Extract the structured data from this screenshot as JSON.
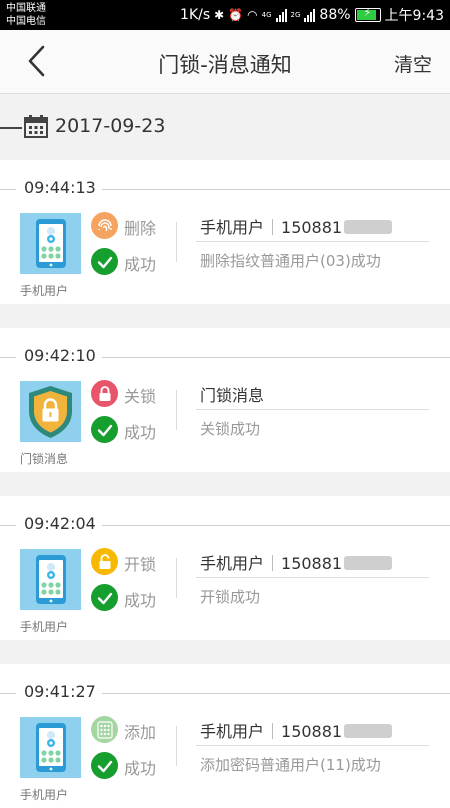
{
  "status_bar": {
    "carrier_1": "中国联通",
    "carrier_2": "中国电信",
    "speed": "1K/s",
    "net_1": "4G",
    "net_2": "2G",
    "battery": "88%",
    "time": "上午9:43"
  },
  "header": {
    "title": "门锁-消息通知",
    "clear_label": "清空"
  },
  "date": "2017-09-23",
  "icons": {
    "back": "back-arrow-icon",
    "calendar": "calendar-icon",
    "fingerprint": "fingerprint-icon",
    "lock_closed": "lock-icon",
    "lock_open": "unlock-icon",
    "keypad": "keypad-icon",
    "success": "check-icon",
    "phone_device": "phone-device-icon",
    "door_lock_device": "shield-lock-icon"
  },
  "colors": {
    "success_green": "#169f2e",
    "delete_orange": "#f4a460",
    "close_red": "#e8556b",
    "open_yellow": "#f6b800",
    "add_green": "#a3d6a0",
    "device_bg": "#8fd0ef"
  },
  "messages": [
    {
      "time": "09:44:13",
      "caption": "手机用户",
      "action": "删除",
      "result": "成功",
      "source": "手机用户",
      "phone_prefix": "150881",
      "detail": "删除指纹普通用户(03)成功"
    },
    {
      "time": "09:42:10",
      "caption": "门锁消息",
      "action": "关锁",
      "result": "成功",
      "source": "门锁消息",
      "detail": "关锁成功"
    },
    {
      "time": "09:42:04",
      "caption": "手机用户",
      "action": "开锁",
      "result": "成功",
      "source": "手机用户",
      "phone_prefix": "150881",
      "detail": "开锁成功"
    },
    {
      "time": "09:41:27",
      "caption": "手机用户",
      "action": "添加",
      "result": "成功",
      "source": "手机用户",
      "phone_prefix": "150881",
      "detail": "添加密码普通用户(11)成功"
    }
  ]
}
